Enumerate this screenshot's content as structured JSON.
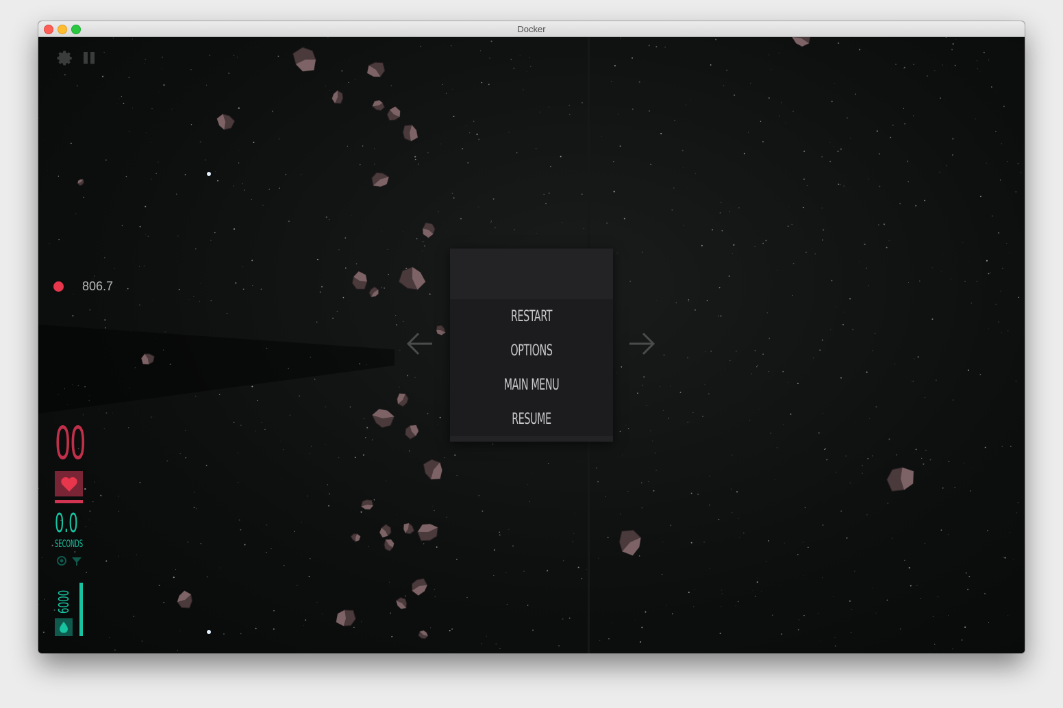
{
  "window": {
    "title": "Docker"
  },
  "controls": {
    "settings_icon": "gear-icon",
    "pause_icon": "pause-icon"
  },
  "target": {
    "distance": "806.7",
    "color": "#e8364c"
  },
  "menu": {
    "items": [
      {
        "label": "RESTART"
      },
      {
        "label": "OPTIONS"
      },
      {
        "label": "MAIN MENU"
      },
      {
        "label": "RESUME"
      }
    ]
  },
  "hud": {
    "count": "00",
    "lives_icon": "heart-icon",
    "lives_color": "#d13450",
    "time_value": "0.0",
    "time_unit": "SECONDS",
    "fuel_value": "6000",
    "fuel_icon": "drop-icon",
    "fuel_level": 1.0,
    "accent": "#17c3a0"
  },
  "navigation": {
    "left": "arrow-left-icon",
    "right": "arrow-right-icon"
  }
}
